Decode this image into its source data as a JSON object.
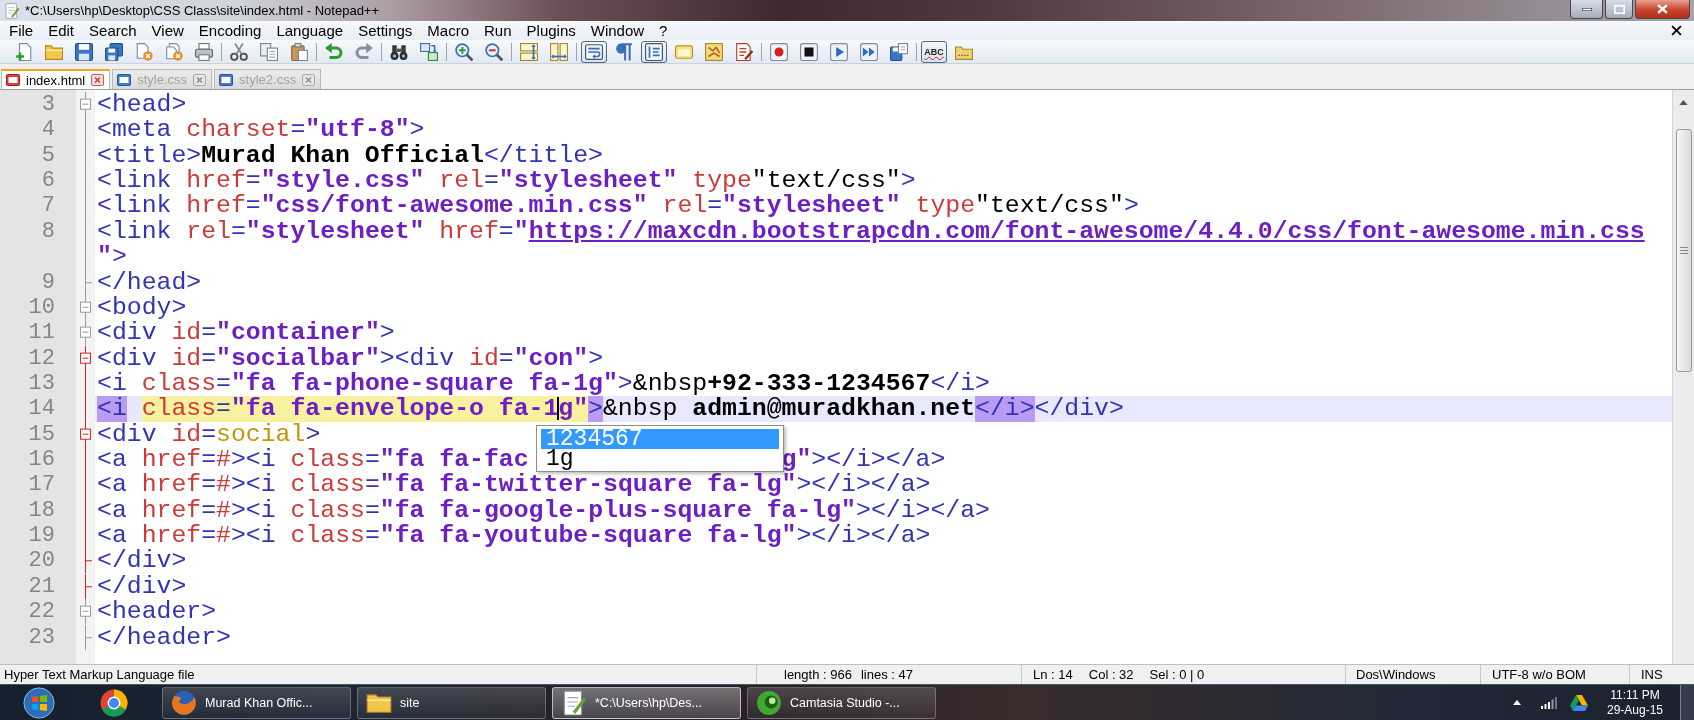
{
  "window": {
    "title": "*C:\\Users\\hp\\Desktop\\CSS Class\\site\\index.html - Notepad++"
  },
  "menu": [
    {
      "label": "File"
    },
    {
      "label": "Edit"
    },
    {
      "label": "Search"
    },
    {
      "label": "View"
    },
    {
      "label": "Encoding"
    },
    {
      "label": "Language"
    },
    {
      "label": "Settings"
    },
    {
      "label": "Macro"
    },
    {
      "label": "Run"
    },
    {
      "label": "Plugins"
    },
    {
      "label": "Window"
    },
    {
      "label": "?"
    }
  ],
  "toolbar": [
    {
      "kind": "button",
      "pressed": false
    },
    {
      "kind": "button",
      "pressed": false
    },
    {
      "kind": "button",
      "pressed": false
    },
    {
      "kind": "button",
      "pressed": false
    },
    {
      "kind": "button",
      "pressed": false
    },
    {
      "kind": "button",
      "pressed": false
    },
    {
      "kind": "button",
      "pressed": false
    },
    {
      "kind": "separator"
    },
    {
      "kind": "button",
      "pressed": false
    },
    {
      "kind": "button",
      "pressed": false
    },
    {
      "kind": "button",
      "pressed": false
    },
    {
      "kind": "separator"
    },
    {
      "kind": "button",
      "pressed": false
    },
    {
      "kind": "button",
      "pressed": false
    },
    {
      "kind": "separator"
    },
    {
      "kind": "button",
      "pressed": false
    },
    {
      "kind": "button",
      "pressed": false
    },
    {
      "kind": "separator"
    },
    {
      "kind": "button",
      "pressed": false
    },
    {
      "kind": "button",
      "pressed": false
    },
    {
      "kind": "separator"
    },
    {
      "kind": "button",
      "pressed": false
    },
    {
      "kind": "button",
      "pressed": false
    },
    {
      "kind": "separator"
    },
    {
      "kind": "button",
      "pressed": true
    },
    {
      "kind": "button",
      "pressed": false
    },
    {
      "kind": "button",
      "pressed": true
    },
    {
      "kind": "button",
      "pressed": false
    },
    {
      "kind": "button",
      "pressed": false
    },
    {
      "kind": "button",
      "pressed": false
    },
    {
      "kind": "separator"
    },
    {
      "kind": "button",
      "pressed": false
    },
    {
      "kind": "button",
      "pressed": false
    },
    {
      "kind": "button",
      "pressed": false
    },
    {
      "kind": "button",
      "pressed": false
    },
    {
      "kind": "button",
      "pressed": false
    },
    {
      "kind": "separator"
    },
    {
      "kind": "button",
      "pressed": true,
      "label": "ABC"
    },
    {
      "kind": "button",
      "pressed": false
    }
  ],
  "tabs": [
    {
      "label": "index.html",
      "selected": true,
      "modified": true
    },
    {
      "label": "style.css",
      "selected": false,
      "modified": false
    },
    {
      "label": "style2.css",
      "selected": false,
      "modified": false
    }
  ],
  "editor": {
    "rows": [
      {
        "number": "3",
        "fold": {
          "kind": "open",
          "active": false
        },
        "current": false,
        "tokens": [
          {
            "kind": "tag",
            "text": "<head>"
          }
        ]
      },
      {
        "number": "4",
        "fold": {
          "kind": "line",
          "active": false
        },
        "current": false,
        "tokens": [
          {
            "kind": "tag",
            "text": "<meta"
          },
          {
            "kind": "space"
          },
          {
            "kind": "attr",
            "text": "charset"
          },
          {
            "kind": "tag",
            "text": "="
          },
          {
            "kind": "value",
            "text": "\"utf-8\""
          },
          {
            "kind": "tag",
            "text": ">"
          }
        ]
      },
      {
        "number": "5",
        "fold": {
          "kind": "line",
          "active": false
        },
        "current": false,
        "tokens": [
          {
            "kind": "tag",
            "text": "<title>"
          },
          {
            "kind": "text",
            "text": "Murad Khan Official"
          },
          {
            "kind": "tag",
            "text": "</title>"
          }
        ]
      },
      {
        "number": "6",
        "fold": {
          "kind": "line",
          "active": false
        },
        "current": false,
        "tokens": [
          {
            "kind": "tag",
            "text": "<link"
          },
          {
            "kind": "space"
          },
          {
            "kind": "attr",
            "text": "href"
          },
          {
            "kind": "tag",
            "text": "="
          },
          {
            "kind": "value",
            "text": "\"style.css\""
          },
          {
            "kind": "space"
          },
          {
            "kind": "attr",
            "text": "rel"
          },
          {
            "kind": "tag",
            "text": "="
          },
          {
            "kind": "value",
            "text": "\"stylesheet\""
          },
          {
            "kind": "space"
          },
          {
            "kind": "attr",
            "text": "type"
          },
          {
            "kind": "plain",
            "text": "\"text/css\""
          },
          {
            "kind": "tag",
            "text": ">"
          }
        ]
      },
      {
        "number": "7",
        "fold": {
          "kind": "line",
          "active": false
        },
        "current": false,
        "tokens": [
          {
            "kind": "tag",
            "text": "<link"
          },
          {
            "kind": "space"
          },
          {
            "kind": "attr",
            "text": "href"
          },
          {
            "kind": "tag",
            "text": "="
          },
          {
            "kind": "value",
            "text": "\"css/font-awesome.min.css\""
          },
          {
            "kind": "space"
          },
          {
            "kind": "attr",
            "text": "rel"
          },
          {
            "kind": "tag",
            "text": "="
          },
          {
            "kind": "value",
            "text": "\"stylesheet\""
          },
          {
            "kind": "space"
          },
          {
            "kind": "attr",
            "text": "type"
          },
          {
            "kind": "plain",
            "text": "\"text/css\""
          },
          {
            "kind": "tag",
            "text": ">"
          }
        ]
      },
      {
        "number": "8",
        "fold": {
          "kind": "line",
          "active": false
        },
        "current": false,
        "tokens": [
          {
            "kind": "tag",
            "text": "<link"
          },
          {
            "kind": "space"
          },
          {
            "kind": "attr",
            "text": "rel"
          },
          {
            "kind": "tag",
            "text": "="
          },
          {
            "kind": "value",
            "text": "\"stylesheet\""
          },
          {
            "kind": "space"
          },
          {
            "kind": "attr",
            "text": "href"
          },
          {
            "kind": "tag",
            "text": "="
          },
          {
            "kind": "value",
            "text": "\""
          },
          {
            "kind": "link",
            "text": "https://maxcdn.bootstrapcdn.com/font-awesome/4.4.0/css/font-awesome.min.css"
          }
        ]
      },
      {
        "fold": {
          "kind": "line",
          "active": false
        },
        "current": false,
        "tokens": [
          {
            "kind": "value",
            "text": "\""
          },
          {
            "kind": "tag",
            "text": ">"
          }
        ]
      },
      {
        "number": "9",
        "fold": {
          "kind": "end",
          "active": false
        },
        "current": false,
        "tokens": [
          {
            "kind": "tag",
            "text": "</head>"
          }
        ]
      },
      {
        "number": "10",
        "fold": {
          "kind": "open",
          "active": false
        },
        "current": false,
        "tokens": [
          {
            "kind": "tag",
            "text": "<body>"
          }
        ]
      },
      {
        "number": "11",
        "fold": {
          "kind": "open",
          "active": false
        },
        "current": false,
        "tokens": [
          {
            "kind": "tag",
            "text": "<div"
          },
          {
            "kind": "space"
          },
          {
            "kind": "attr",
            "text": "id"
          },
          {
            "kind": "tag",
            "text": "="
          },
          {
            "kind": "value",
            "text": "\"container\""
          },
          {
            "kind": "tag",
            "text": ">"
          }
        ]
      },
      {
        "number": "12",
        "fold": {
          "kind": "open",
          "active": true
        },
        "current": false,
        "tokens": [
          {
            "kind": "tag",
            "text": "<div"
          },
          {
            "kind": "space"
          },
          {
            "kind": "attr",
            "text": "id"
          },
          {
            "kind": "tag",
            "text": "="
          },
          {
            "kind": "value",
            "text": "\"socialbar\""
          },
          {
            "kind": "tag",
            "text": "><div"
          },
          {
            "kind": "space"
          },
          {
            "kind": "attr",
            "text": "id"
          },
          {
            "kind": "tag",
            "text": "="
          },
          {
            "kind": "value",
            "text": "\"con\""
          },
          {
            "kind": "tag",
            "text": ">"
          }
        ]
      },
      {
        "number": "13",
        "fold": {
          "kind": "line",
          "active": true
        },
        "current": false,
        "tokens": [
          {
            "kind": "tag",
            "text": "<i"
          },
          {
            "kind": "space"
          },
          {
            "kind": "attr",
            "text": "class"
          },
          {
            "kind": "tag",
            "text": "="
          },
          {
            "kind": "value",
            "text": "\"fa fa-phone-square fa-1g\""
          },
          {
            "kind": "tag",
            "text": ">"
          },
          {
            "kind": "entity",
            "text": "&nbsp"
          },
          {
            "kind": "text",
            "text": "+92-333-1234567"
          },
          {
            "kind": "tag",
            "text": "</i>"
          }
        ]
      },
      {
        "number": "14",
        "fold": {
          "kind": "line",
          "active": true
        },
        "current": true,
        "tokens": [
          {
            "kind": "tag",
            "text": "<i",
            "tag_match": true,
            "attr_match": false
          },
          {
            "kind": "space",
            "tag_match": false,
            "attr_match": false
          },
          {
            "kind": "attr",
            "text": "class",
            "tag_match": false,
            "attr_match": true
          },
          {
            "kind": "tag",
            "text": "=",
            "tag_match": false,
            "attr_match": true
          },
          {
            "kind": "value",
            "text": "\"fa fa-envelope-o fa-1",
            "tag_match": false,
            "attr_match": true
          },
          {
            "kind": "caret"
          },
          {
            "kind": "value",
            "text": "g\"",
            "tag_match": false,
            "attr_match": true
          },
          {
            "kind": "tag",
            "text": ">",
            "tag_match": true,
            "attr_match": false
          },
          {
            "kind": "entity",
            "text": "&nbsp",
            "tag_match": false,
            "attr_match": false
          },
          {
            "kind": "space",
            "tag_match": false,
            "attr_match": false
          },
          {
            "kind": "text",
            "text": "admin@muradkhan.net",
            "tag_match": false,
            "attr_match": false
          },
          {
            "kind": "tag",
            "text": "</i>",
            "tag_match": true,
            "attr_match": false
          },
          {
            "kind": "tag",
            "text": "</div>",
            "tag_match": false,
            "attr_match": false
          }
        ]
      },
      {
        "number": "15",
        "fold": {
          "kind": "open",
          "active": true
        },
        "current": false,
        "tokens": [
          {
            "kind": "tag",
            "text": "<div"
          },
          {
            "kind": "space"
          },
          {
            "kind": "attr",
            "text": "id"
          },
          {
            "kind": "tag",
            "text": "="
          },
          {
            "kind": "unquoted",
            "text": "social"
          },
          {
            "kind": "tag",
            "text": ">"
          }
        ]
      },
      {
        "number": "16",
        "fold": {
          "kind": "line",
          "active": true
        },
        "current": false,
        "tokens": [
          {
            "kind": "tag",
            "text": "<a"
          },
          {
            "kind": "space"
          },
          {
            "kind": "attr",
            "text": "href"
          },
          {
            "kind": "tag",
            "text": "="
          },
          {
            "kind": "attr",
            "text": "#"
          },
          {
            "kind": "tag",
            "text": "><i"
          },
          {
            "kind": "space"
          },
          {
            "kind": "attr",
            "text": "class"
          },
          {
            "kind": "tag",
            "text": "="
          },
          {
            "kind": "value",
            "text": "\"fa fa-fac"
          },
          {
            "kind": "gap"
          },
          {
            "kind": "value",
            "text": "g\""
          },
          {
            "kind": "tag",
            "text": "></i></a>"
          }
        ]
      },
      {
        "number": "17",
        "fold": {
          "kind": "line",
          "active": true
        },
        "current": false,
        "tokens": [
          {
            "kind": "tag",
            "text": "<a"
          },
          {
            "kind": "space"
          },
          {
            "kind": "attr",
            "text": "href"
          },
          {
            "kind": "tag",
            "text": "="
          },
          {
            "kind": "attr",
            "text": "#"
          },
          {
            "kind": "tag",
            "text": "><i"
          },
          {
            "kind": "space"
          },
          {
            "kind": "attr",
            "text": "class"
          },
          {
            "kind": "tag",
            "text": "="
          },
          {
            "kind": "value",
            "text": "\"fa fa-twitter-square fa-lg\""
          },
          {
            "kind": "tag",
            "text": "></i></a>"
          }
        ]
      },
      {
        "number": "18",
        "fold": {
          "kind": "line",
          "active": true
        },
        "current": false,
        "tokens": [
          {
            "kind": "tag",
            "text": "<a"
          },
          {
            "kind": "space"
          },
          {
            "kind": "attr",
            "text": "href"
          },
          {
            "kind": "tag",
            "text": "="
          },
          {
            "kind": "attr",
            "text": "#"
          },
          {
            "kind": "tag",
            "text": "><i"
          },
          {
            "kind": "space"
          },
          {
            "kind": "attr",
            "text": "class"
          },
          {
            "kind": "tag",
            "text": "="
          },
          {
            "kind": "value",
            "text": "\"fa fa-google-plus-square fa-lg\""
          },
          {
            "kind": "tag",
            "text": "></i></a>"
          }
        ]
      },
      {
        "number": "19",
        "fold": {
          "kind": "line",
          "active": true
        },
        "current": false,
        "tokens": [
          {
            "kind": "tag",
            "text": "<a"
          },
          {
            "kind": "space"
          },
          {
            "kind": "attr",
            "text": "href"
          },
          {
            "kind": "tag",
            "text": "="
          },
          {
            "kind": "attr",
            "text": "#"
          },
          {
            "kind": "tag",
            "text": "><i"
          },
          {
            "kind": "space"
          },
          {
            "kind": "attr",
            "text": "class"
          },
          {
            "kind": "tag",
            "text": "="
          },
          {
            "kind": "value",
            "text": "\"fa fa-youtube-square fa-lg\""
          },
          {
            "kind": "tag",
            "text": "></i></a>"
          }
        ]
      },
      {
        "number": "20",
        "fold": {
          "kind": "end",
          "active": true
        },
        "current": false,
        "tokens": [
          {
            "kind": "tag",
            "text": "</div>"
          }
        ]
      },
      {
        "number": "21",
        "fold": {
          "kind": "end",
          "active": true
        },
        "current": false,
        "tokens": [
          {
            "kind": "tag",
            "text": "</div>"
          }
        ]
      },
      {
        "number": "22",
        "fold": {
          "kind": "open",
          "active": false
        },
        "current": false,
        "tokens": [
          {
            "kind": "tag",
            "text": "<header>"
          }
        ]
      },
      {
        "number": "23",
        "fold": {
          "kind": "end",
          "active": false
        },
        "current": false,
        "tokens": [
          {
            "kind": "tag",
            "text": "</header>"
          }
        ]
      }
    ],
    "autocomplete": [
      {
        "text": "1234567",
        "selected": true
      },
      {
        "text": "1g",
        "selected": false
      }
    ]
  },
  "status_bar": [
    {
      "texts": [
        "Hyper Text Markup Language file"
      ]
    },
    {
      "texts": [
        "length : 966",
        "lines : 47"
      ]
    },
    {
      "texts": [
        "Ln : 14",
        "Col : 32",
        "Sel : 0 | 0"
      ]
    },
    {
      "texts": [
        "Dos\\Windows"
      ]
    },
    {
      "texts": [
        "UTF-8 w/o BOM"
      ]
    },
    {
      "texts": [
        "INS"
      ]
    }
  ],
  "taskbar": {
    "buttons": [
      {
        "kind": "start"
      },
      {
        "kind": "pinned"
      },
      {
        "kind": "window",
        "label": "Murad Khan Offic...",
        "selected": false
      },
      {
        "kind": "window",
        "label": "site",
        "selected": false
      },
      {
        "kind": "window",
        "label": "*C:\\Users\\hp\\Des...",
        "selected": true
      },
      {
        "kind": "window",
        "label": "Camtasia Studio -...",
        "selected": false
      }
    ],
    "clock": {
      "time": "11:11 PM",
      "date": "29-Aug-15"
    }
  }
}
